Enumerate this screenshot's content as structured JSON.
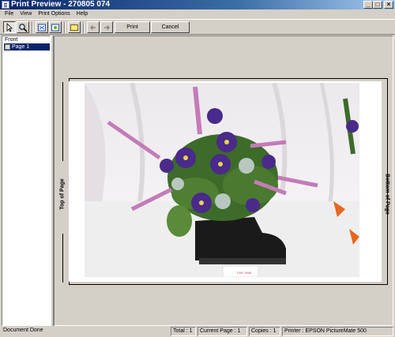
{
  "window": {
    "title": "Print Preview - 270805 074",
    "minimize": "_",
    "maximize": "□",
    "close": "×"
  },
  "menu": [
    "File",
    "View",
    "Print Options",
    "Help"
  ],
  "toolbar": {
    "print_label": "Print",
    "cancel_label": "Cancel"
  },
  "tree": {
    "root": "Front",
    "items": [
      "Page 1"
    ]
  },
  "preview": {
    "left_label": "Top of Page",
    "right_label": "Bottom of Page",
    "card_text": "FAR TIME"
  },
  "status": {
    "message": "Document Done",
    "total": "Total : 1",
    "current_page": "Current Page : 1",
    "copies": "Copies : 1",
    "printer": "Printer : EPSON PictureMate 500"
  },
  "colors": {
    "title_active": "#0a246a",
    "selection": "#0a246a",
    "face": "#d4d0c8"
  },
  "icons": [
    "pointer-icon",
    "zoom-icon",
    "fit-page-icon",
    "fit-width-icon",
    "page-icon",
    "back-arrow-icon",
    "forward-arrow-icon"
  ]
}
